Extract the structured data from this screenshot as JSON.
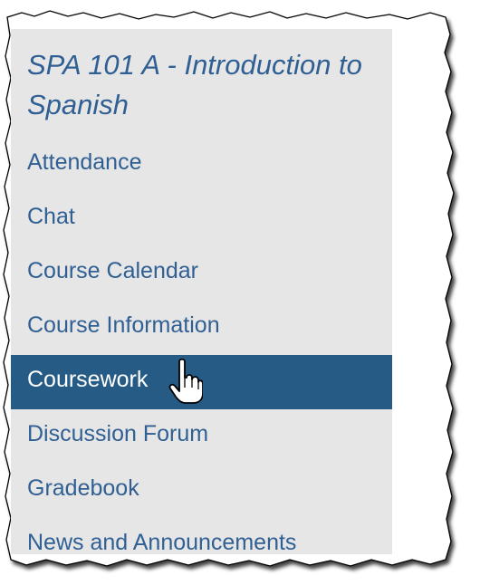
{
  "sidebar": {
    "course_title": "SPA 101 A - Introduction to Spanish",
    "active_item": "Coursework",
    "items": [
      {
        "label": "Attendance"
      },
      {
        "label": "Chat"
      },
      {
        "label": "Course Calendar"
      },
      {
        "label": "Course Information"
      },
      {
        "label": "Coursework"
      },
      {
        "label": "Discussion Forum"
      },
      {
        "label": "Gradebook"
      },
      {
        "label": "News and Announcements"
      }
    ]
  },
  "cursor": {
    "icon": "hand-pointer-icon"
  },
  "colors": {
    "link": "#2f5f93",
    "panel_background": "#e6e6e6",
    "active_background": "#265b86",
    "active_text": "#ffffff"
  }
}
